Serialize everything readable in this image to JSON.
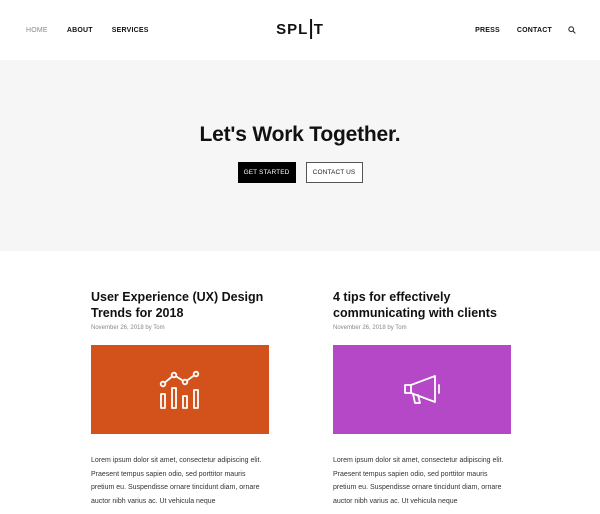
{
  "header": {
    "nav_left": [
      "HOME",
      "ABOUT",
      "SERVICES"
    ],
    "logo_left": "SPL",
    "logo_right": "T",
    "nav_right": [
      "PRESS",
      "CONTACT"
    ],
    "search_icon": "search-icon"
  },
  "hero": {
    "title": "Let's Work Together.",
    "primary_button": "GET STARTED",
    "secondary_button": "CONTACT US",
    "background": "#f6f6f6"
  },
  "posts": [
    {
      "title": "User Experience (UX) Design Trends for 2018",
      "meta": "November 26, 2018 by Tom",
      "image_color": "#d3521b",
      "image_icon": "bar-chart-icon",
      "excerpt": "Lorem ipsum dolor sit amet, consectetur adipiscing elit. Praesent tempus sapien odio, sed porttitor mauris pretium eu. Suspendisse ornare tincidunt diam, ornare auctor nibh varius ac. Ut vehicula neque"
    },
    {
      "title": "4 tips for effectively communicating with clients",
      "meta": "November 26, 2018 by Tom",
      "image_color": "#b548c6",
      "image_icon": "megaphone-icon",
      "excerpt": "Lorem ipsum dolor sit amet, consectetur adipiscing elit. Praesent tempus sapien odio, sed porttitor mauris pretium eu. Suspendisse ornare tincidunt diam, ornare auctor nibh varius ac. Ut vehicula neque"
    }
  ]
}
